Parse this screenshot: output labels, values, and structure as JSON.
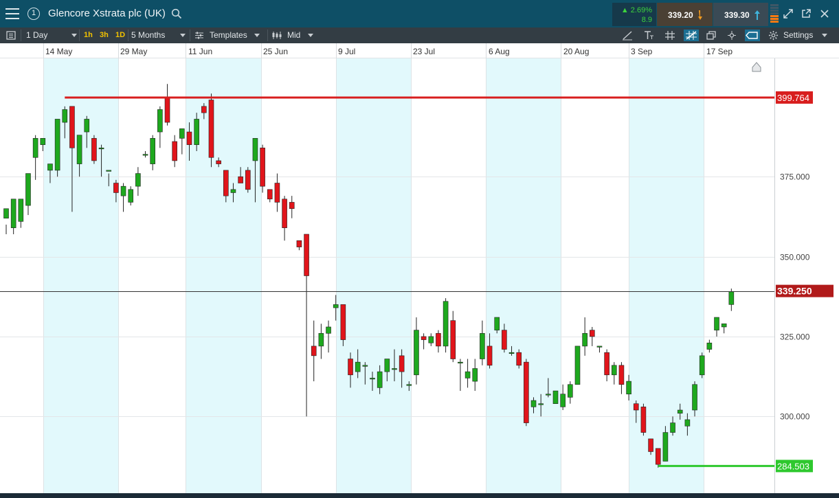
{
  "window": {
    "badge": "1",
    "instrument": "Glencore Xstrata plc (UK)",
    "change_pct": "2.69%",
    "change_pts": "8.9",
    "sell_price": "339.20",
    "buy_price": "339.30"
  },
  "toolbar": {
    "interval": "1 Day",
    "quick_frames": [
      "1h",
      "3h",
      "1D"
    ],
    "range": "5 Months",
    "templates": "Templates",
    "price_type": "Mid",
    "settings": "Settings"
  },
  "colors": {
    "up": "#1ea81e",
    "down": "#e0151b",
    "high_line": "#d81e1e",
    "low_line": "#2ec82e",
    "last_price": "#b11a1a",
    "band": "#e2f9fc"
  },
  "chart_data": {
    "type": "candlestick",
    "x_labels": [
      "14 May",
      "29 May",
      "11 Jun",
      "25 Jun",
      "9 Jul",
      "23 Jul",
      "6 Aug",
      "20 Aug",
      "3 Sep",
      "17 Sep"
    ],
    "y_ticks": [
      "375.000",
      "350.000",
      "325.000",
      "300.000"
    ],
    "ylim": [
      276,
      412
    ],
    "high_marker": "399.764",
    "low_marker": "284.503",
    "last_price": "339.250",
    "candles": [
      [
        362.0,
        365.0,
        357.0,
        360.0
      ],
      [
        359.0,
        368.0,
        357.0,
        367.0
      ],
      [
        361.0,
        368.0,
        359.0,
        368.0
      ],
      [
        366.0,
        376.0,
        363.0,
        376.0
      ],
      [
        381.0,
        387.0,
        374.0,
        388.0
      ],
      [
        385.0,
        387.0,
        383.0,
        386.0
      ],
      [
        377.0,
        379.0,
        373.0,
        378.0
      ],
      [
        377.0,
        393.0,
        375.0,
        390.0
      ],
      [
        392.0,
        396.0,
        387.0,
        397.0
      ],
      [
        397.0,
        384.0,
        364.0,
        394.0
      ],
      [
        379.0,
        388.0,
        375.0,
        387.0
      ],
      [
        389.0,
        393.0,
        384.0,
        394.0
      ],
      [
        387.0,
        380.0,
        379.0,
        388.0
      ],
      [
        384.0,
        384.0,
        375.0,
        385.0
      ],
      [
        377.0,
        377.0,
        372.0,
        376.0
      ],
      [
        373.0,
        370.0,
        367.0,
        374.0
      ],
      [
        369.0,
        372.0,
        364.0,
        373.0
      ],
      [
        367.0,
        371.0,
        366.0,
        372.0
      ],
      [
        372.0,
        376.0,
        369.0,
        378.0
      ],
      [
        382.0,
        382.0,
        381.0,
        383.0
      ],
      [
        379.0,
        387.0,
        377.0,
        388.0
      ],
      [
        389.0,
        396.0,
        384.0,
        397.0
      ],
      [
        400.0,
        392.0,
        391.0,
        404.0
      ],
      [
        386.0,
        380.0,
        378.0,
        388.0
      ],
      [
        387.0,
        390.0,
        382.0,
        390.0
      ],
      [
        389.0,
        385.0,
        380.0,
        392.0
      ],
      [
        385.0,
        393.0,
        383.0,
        395.0
      ],
      [
        397.0,
        395.0,
        393.0,
        398.0
      ],
      [
        399.0,
        381.0,
        378.0,
        401.0
      ],
      [
        380.0,
        379.0,
        378.0,
        381.0
      ],
      [
        377.0,
        369.0,
        367.0,
        377.0
      ],
      [
        370.0,
        371.0,
        367.0,
        373.0
      ],
      [
        375.0,
        373.0,
        374.0,
        378.0
      ],
      [
        377.0,
        371.0,
        370.0,
        378.0
      ],
      [
        380.0,
        387.0,
        367.0,
        387.0
      ],
      [
        384.0,
        372.0,
        370.0,
        385.0
      ],
      [
        371.0,
        368.0,
        367.0,
        371.0
      ],
      [
        373.0,
        367.0,
        364.0,
        376.0
      ],
      [
        368.0,
        359.0,
        355.0,
        369.0
      ],
      [
        367.0,
        365.0,
        362.0,
        369.0
      ],
      [
        355.0,
        353.0,
        352.0,
        355.0
      ],
      [
        357.0,
        344.0,
        300.0,
        355.0
      ],
      [
        322.0,
        319.0,
        311.0,
        330.0
      ],
      [
        322.0,
        326.0,
        318.0,
        329.0
      ],
      [
        326.0,
        328.0,
        320.0,
        330.0
      ],
      [
        334.0,
        335.0,
        330.0,
        338.0
      ],
      [
        335.0,
        324.0,
        322.0,
        335.0
      ],
      [
        318.0,
        313.0,
        309.0,
        320.0
      ],
      [
        314.0,
        317.0,
        312.0,
        321.0
      ],
      [
        316.0,
        316.0,
        310.0,
        317.0
      ],
      [
        312.0,
        312.0,
        308.0,
        314.0
      ],
      [
        309.0,
        314.0,
        307.0,
        316.0
      ],
      [
        314.0,
        318.0,
        311.0,
        318.0
      ],
      [
        315.0,
        315.0,
        311.0,
        321.0
      ],
      [
        319.0,
        314.0,
        309.0,
        321.0
      ],
      [
        310.0,
        310.0,
        308.0,
        311.0
      ],
      [
        313.0,
        327.0,
        310.0,
        331.0
      ],
      [
        325.0,
        324.0,
        321.0,
        326.0
      ],
      [
        323.0,
        325.0,
        322.0,
        326.0
      ],
      [
        326.0,
        322.0,
        320.0,
        327.0
      ],
      [
        322.0,
        336.0,
        320.0,
        337.0
      ],
      [
        330.0,
        318.0,
        317.0,
        333.0
      ],
      [
        317.0,
        317.0,
        308.0,
        318.0
      ],
      [
        312.0,
        314.0,
        309.0,
        318.0
      ],
      [
        311.0,
        315.0,
        308.0,
        318.0
      ],
      [
        318.0,
        326.0,
        316.0,
        330.0
      ],
      [
        322.0,
        316.0,
        315.0,
        326.0
      ],
      [
        327.0,
        331.0,
        326.0,
        331.0
      ],
      [
        327.0,
        321.0,
        320.0,
        329.0
      ],
      [
        320.0,
        320.0,
        319.0,
        322.0
      ],
      [
        320.0,
        316.0,
        315.0,
        321.0
      ],
      [
        317.0,
        298.0,
        297.0,
        318.0
      ],
      [
        303.0,
        305.0,
        301.0,
        306.0
      ],
      [
        304.0,
        304.0,
        300.0,
        307.0
      ],
      [
        307.0,
        307.0,
        306.0,
        312.0
      ],
      [
        304.0,
        308.0,
        304.0,
        307.0
      ],
      [
        303.0,
        307.0,
        302.0,
        310.0
      ],
      [
        306.0,
        310.0,
        304.0,
        311.0
      ],
      [
        310.0,
        322.0,
        310.0,
        322.0
      ],
      [
        322.0,
        326.0,
        319.0,
        331.0
      ],
      [
        327.0,
        325.0,
        322.0,
        328.0
      ],
      [
        322.0,
        322.0,
        320.0,
        322.0
      ],
      [
        320.0,
        313.0,
        311.0,
        321.0
      ],
      [
        313.0,
        316.0,
        310.0,
        317.0
      ],
      [
        316.0,
        310.0,
        307.0,
        317.0
      ],
      [
        307.0,
        311.0,
        305.0,
        313.0
      ],
      [
        304.0,
        302.0,
        298.0,
        305.0
      ],
      [
        303.0,
        295.0,
        294.0,
        304.0
      ],
      [
        293.0,
        289.0,
        288.0,
        293.0
      ],
      [
        290.0,
        285.0,
        284.0,
        290.0
      ],
      [
        286.0,
        295.0,
        286.0,
        297.0
      ],
      [
        295.0,
        298.0,
        294.0,
        300.0
      ],
      [
        301.0,
        302.0,
        299.0,
        304.0
      ],
      [
        297.0,
        299.0,
        294.0,
        301.0
      ],
      [
        302.0,
        310.0,
        300.0,
        311.0
      ],
      [
        313.0,
        319.0,
        312.0,
        320.0
      ],
      [
        321.0,
        323.0,
        320.0,
        324.0
      ],
      [
        327.0,
        331.0,
        325.0,
        331.0
      ],
      [
        328.0,
        329.0,
        326.0,
        329.0
      ],
      [
        335.0,
        339.0,
        333.0,
        340.0
      ]
    ]
  }
}
